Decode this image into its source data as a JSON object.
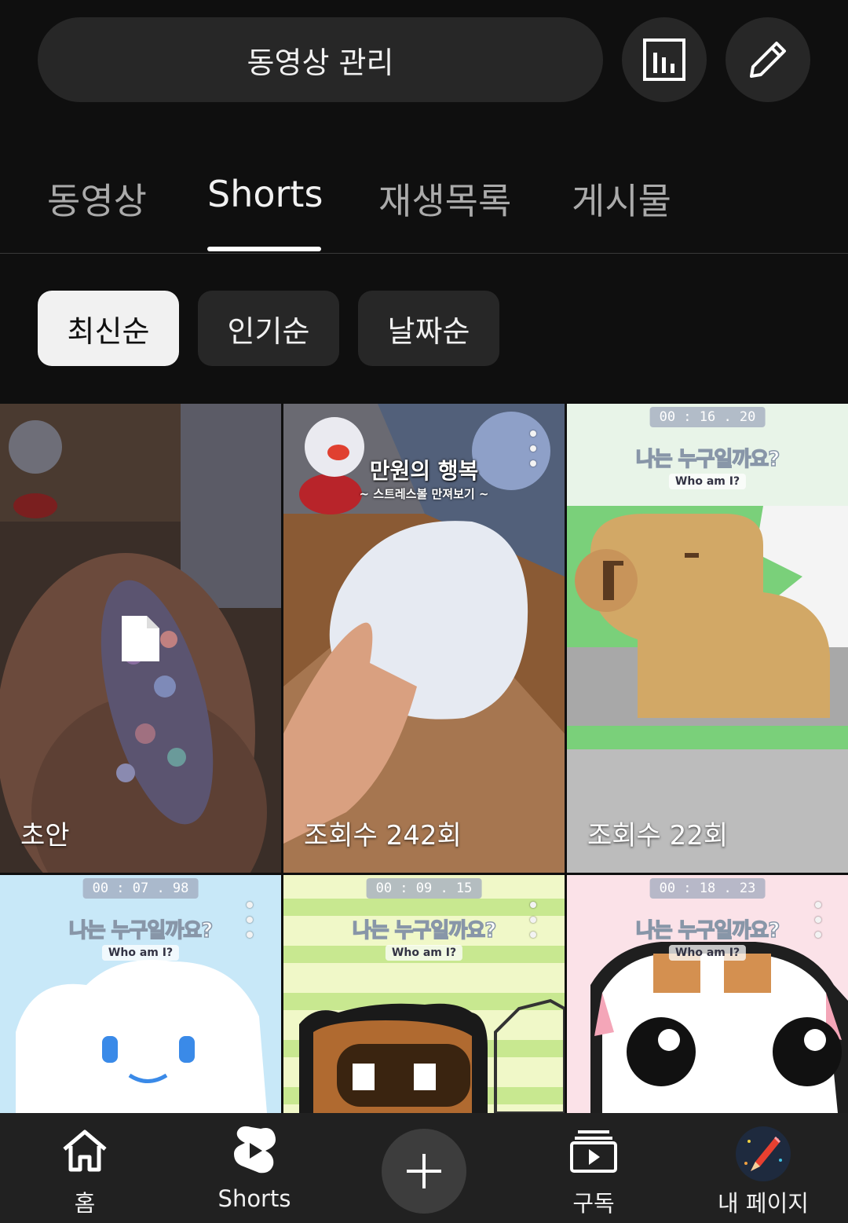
{
  "header": {
    "manage_label": "동영상 관리",
    "analytics_icon": "bar-chart-icon",
    "edit_icon": "pencil-icon"
  },
  "tabs": [
    {
      "label": "동영상",
      "active": false
    },
    {
      "label": "Shorts",
      "active": true
    },
    {
      "label": "재생목록",
      "active": false
    },
    {
      "label": "게시물",
      "active": false
    }
  ],
  "filters": [
    {
      "label": "최신순",
      "active": true
    },
    {
      "label": "인기순",
      "active": false
    },
    {
      "label": "날짜순",
      "active": false
    }
  ],
  "videos": [
    {
      "label": "초안",
      "overlay_icon": "draft-document-icon"
    },
    {
      "label": "조회수 242회",
      "title": "만원의 행복",
      "subtitle": "~ 스트레스볼 만져보기 ~"
    },
    {
      "label": "조회수 22회",
      "timer": "00 : 16 . 20",
      "title": "나는 누구일까요?",
      "subtitle": "Who am I?"
    },
    {
      "label": "",
      "timer": "00 : 07 . 98",
      "title": "나는 누구일까요?",
      "subtitle": "Who am I?"
    },
    {
      "label": "",
      "timer": "00 : 09 . 15",
      "title": "나는 누구일까요?",
      "subtitle": "Who am I?"
    },
    {
      "label": "",
      "timer": "00 : 18 . 23",
      "title": "나는 누구일까요?",
      "subtitle": "Who am I?"
    }
  ],
  "nav": [
    {
      "label": "홈",
      "icon": "home-icon"
    },
    {
      "label": "Shorts",
      "icon": "shorts-icon"
    },
    {
      "label": "",
      "icon": "plus-icon"
    },
    {
      "label": "구독",
      "icon": "subscriptions-icon"
    },
    {
      "label": "내 페이지",
      "icon": "avatar"
    }
  ],
  "colors": {
    "background": "#0f0f0f",
    "surface": "#272727",
    "nav_background": "#212121"
  }
}
